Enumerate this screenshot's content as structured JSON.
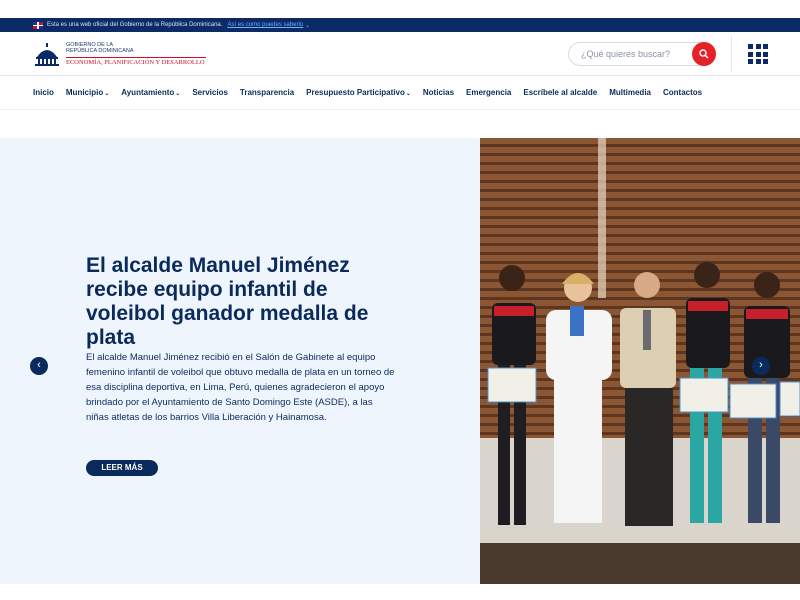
{
  "gov_bar": {
    "text": "Esta es una web oficial del Gobierno de la República Dominicana.",
    "link": "Así es como puedes saberlo"
  },
  "logo": {
    "line1": "GOBIERNO DE LA",
    "line2": "REPÚBLICA DOMINICANA",
    "subtitle": "ECONOMÍA, PLANIFICACIÓN Y DESARROLLO"
  },
  "search": {
    "placeholder": "¿Qué quieres buscar?"
  },
  "nav": {
    "items": [
      {
        "label": "Inicio",
        "dropdown": false
      },
      {
        "label": "Municipio",
        "dropdown": true
      },
      {
        "label": "Ayuntamiento",
        "dropdown": true
      },
      {
        "label": "Servicios",
        "dropdown": false
      },
      {
        "label": "Transparencia",
        "dropdown": false
      },
      {
        "label": "Presupuesto Participativo",
        "dropdown": true
      },
      {
        "label": "Noticias",
        "dropdown": false
      },
      {
        "label": "Emergencia",
        "dropdown": false
      },
      {
        "label": "Escríbele al alcalde",
        "dropdown": false
      },
      {
        "label": "Multimedia",
        "dropdown": false
      },
      {
        "label": "Contactos",
        "dropdown": false
      }
    ]
  },
  "hero": {
    "title": "El alcalde Manuel Jiménez recibe equipo infantil de voleibol ganador medalla de plata",
    "body": "El alcalde Manuel Jiménez recibió en el Salón de Gabinete al equipo femenino infantil de voleibol que obtuvo medalla de plata en un torneo de esa disciplina deportiva, en Lima, Perú, quienes agradecieron el apoyo brindado por el Ayuntamiento de Santo Domingo Este (ASDE), a las niñas atletas de los barrios Villa Liberación y Hainamosa.",
    "button": "LEER MÁS"
  },
  "colors": {
    "primary": "#0b2a5c",
    "accent": "#e5222a",
    "hero_bg": "#eef5fc"
  }
}
